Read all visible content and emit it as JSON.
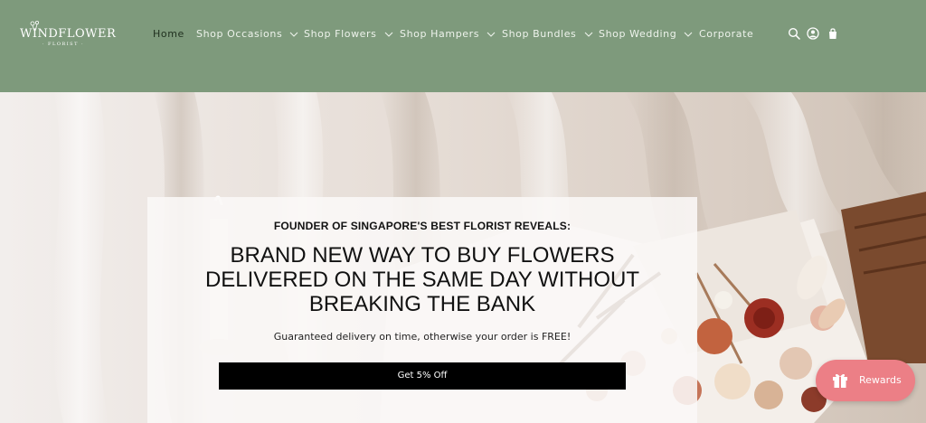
{
  "brand": {
    "name": "WINDFLOWER",
    "tagline": "· FLORIST ·"
  },
  "nav": {
    "items": [
      {
        "label": "Home",
        "active": true,
        "dropdown": false
      },
      {
        "label": "Shop Occasions",
        "active": false,
        "dropdown": true
      },
      {
        "label": "Shop Flowers",
        "active": false,
        "dropdown": true
      },
      {
        "label": "Shop Hampers",
        "active": false,
        "dropdown": true
      },
      {
        "label": "Shop Bundles",
        "active": false,
        "dropdown": true
      },
      {
        "label": "Shop Wedding",
        "active": false,
        "dropdown": true
      },
      {
        "label": "Corporate",
        "active": false,
        "dropdown": false
      }
    ]
  },
  "header_icons": [
    "search-icon",
    "account-icon",
    "cart-icon"
  ],
  "promo": {
    "eyebrow": "FOUNDER OF SINGAPORE'S BEST FLORIST REVEALS:",
    "headline": "BRAND NEW WAY TO BUY FLOWERS DELIVERED ON THE SAME DAY WITHOUT BREAKING THE BANK",
    "subline": "Guaranteed delivery on time, otherwise your order is FREE!",
    "cta_label": "Get 5% Off"
  },
  "rewards": {
    "label": "Rewards",
    "icon": "gift-icon"
  },
  "colors": {
    "header_bg": "#7e9a7c",
    "nav_text": "#eef3ec",
    "nav_active": "#20301f",
    "cta_bg": "#000000",
    "rewards_bg": "#ec7f86"
  }
}
